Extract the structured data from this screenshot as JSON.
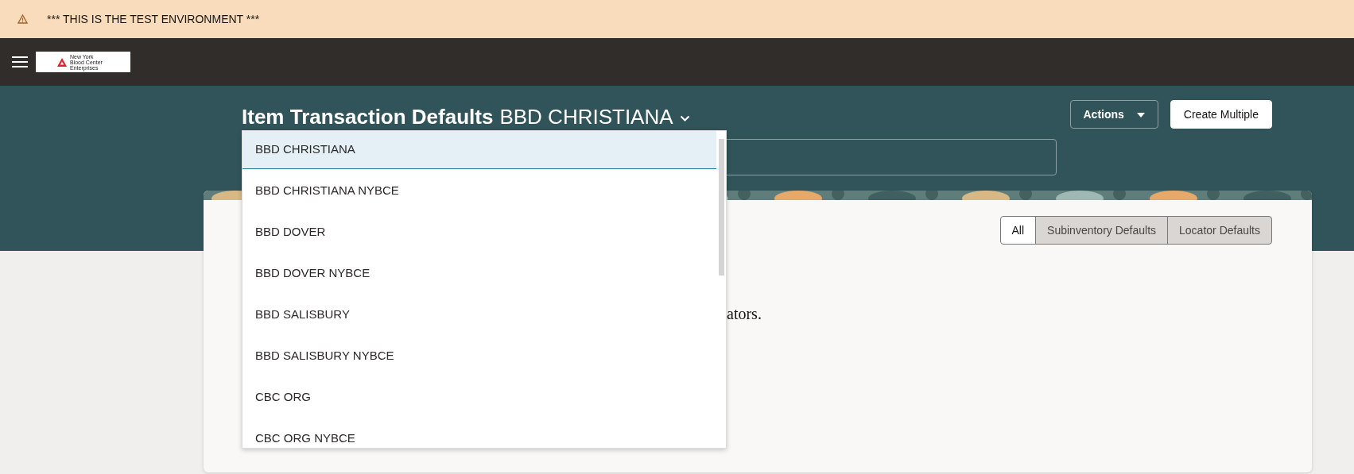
{
  "banner": {
    "text": "*** THIS IS THE TEST ENVIRONMENT ***"
  },
  "logo": {
    "lines": [
      "New York",
      "Blood Center",
      "Enterprises"
    ]
  },
  "header": {
    "title": "Item Transaction Defaults",
    "organization": "BBD CHRISTIANA",
    "buttons": [
      {
        "label": "Actions",
        "kind": "menu"
      },
      {
        "label": "Create Multiple",
        "kind": "primary"
      }
    ]
  },
  "organization_dropdown": {
    "expanded": true,
    "options": [
      {
        "label": "BBD CHRISTIANA",
        "selected": true
      },
      {
        "label": "BBD CHRISTIANA NYBCE",
        "selected": false
      },
      {
        "label": "BBD DOVER",
        "selected": false
      },
      {
        "label": "BBD DOVER NYBCE",
        "selected": false
      },
      {
        "label": "BBD SALISBURY",
        "selected": false
      },
      {
        "label": "BBD SALISBURY NYBCE",
        "selected": false
      },
      {
        "label": "CBC ORG",
        "selected": false
      },
      {
        "label": "CBC ORG NYBCE",
        "selected": false
      }
    ]
  },
  "filter_tabs": [
    {
      "label": "All",
      "selected": true
    },
    {
      "label": "Subinventory Defaults",
      "selected": false
    },
    {
      "label": "Locator Defaults",
      "selected": false
    }
  ],
  "message": {
    "text": "ators."
  }
}
